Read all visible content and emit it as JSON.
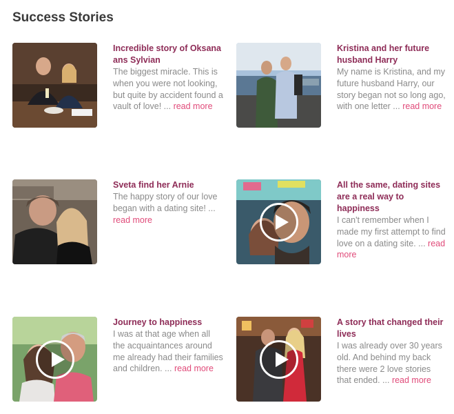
{
  "section": {
    "title": "Success Stories"
  },
  "colors": {
    "title": "#8e2c57",
    "link": "#e04a79",
    "text": "#8a8a8a",
    "heading": "#3a3a3a"
  },
  "stories": [
    {
      "title": "Incredible story  of Oksana ans Sylvian",
      "excerpt": "The biggest miracle. This is when you were not looking, but quite by accident found a vault of love!",
      "ellipsis": " ... ",
      "link": "read more",
      "video": false
    },
    {
      "title": "Kristina and her future husband Harry",
      "excerpt": "My name is Kristina, and my future husband Harry, our story began not so long ago, with one letter",
      "ellipsis": " ... ",
      "link": "read more",
      "video": false
    },
    {
      "title": "Sveta find her Arnie",
      "excerpt": "The happy story of our love began with a dating site!",
      "ellipsis": " ... ",
      "link": "read more",
      "video": false
    },
    {
      "title": "All the same, dating sites are a real way to happiness",
      "excerpt": "I can't remember when I made my first attempt to find love on a dating site.",
      "ellipsis": " ... ",
      "link": "read more",
      "video": true
    },
    {
      "title": "Journey to happiness",
      "excerpt": "I was at that age when all the acquaintances around me already had their families and children.",
      "ellipsis": " ... ",
      "link": "read more",
      "video": true
    },
    {
      "title": "A story that changed their lives",
      "excerpt": "I was already over 30 years old. And behind my back there were 2 love stories that ended.",
      "ellipsis": " ... ",
      "link": "read more",
      "video": true
    }
  ]
}
